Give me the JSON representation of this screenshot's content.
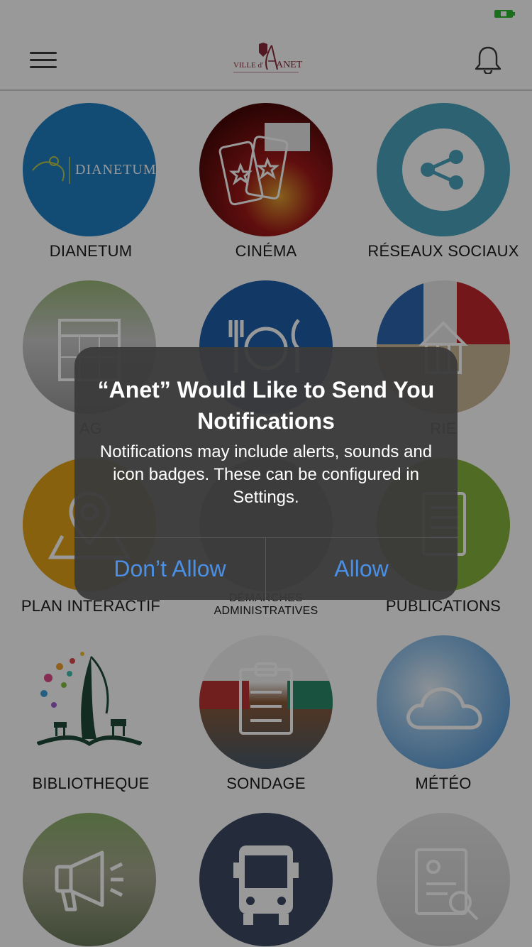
{
  "header": {
    "logo_prefix": "VILLE d'",
    "logo_name": "ANET"
  },
  "tiles": [
    {
      "label": "DIANETUM",
      "logo_text": "DIANETUM",
      "icon": "dianetum-logo",
      "bg": "#1f7fc4"
    },
    {
      "label": "CINÉMA",
      "icon": "cinema-tickets-icon",
      "bg": "#6b1414"
    },
    {
      "label": "RÉSEAUX SOCIAUX",
      "icon": "share-icon",
      "bg": "#4aa3bd"
    },
    {
      "label": "AG",
      "icon": "calendar-icon",
      "bg": "#b0b0b0"
    },
    {
      "label": "",
      "icon": "restaurant-icon",
      "bg": "#1f5fa8"
    },
    {
      "label": "RIE",
      "icon": "town-hall-icon",
      "bg": "#6b86a8"
    },
    {
      "label": "PLAN INTERACTIF",
      "icon": "map-pin-icon",
      "bg": "#e3a21a"
    },
    {
      "label": "DÉMARCHES ADMINISTRATIVES",
      "icon": "admin-icon",
      "bg": "#9a9a9a"
    },
    {
      "label": "PUBLICATIONS",
      "icon": "document-icon",
      "bg": "#86b33b"
    },
    {
      "label": "BIBLIOTHEQUE",
      "icon": "library-logo",
      "bg": "#ffffff"
    },
    {
      "label": "SONDAGE",
      "icon": "survey-icon",
      "bg": "#8a8a8a"
    },
    {
      "label": "MÉTÉO",
      "icon": "cloud-icon",
      "bg": "#4f9bd8"
    },
    {
      "label": "",
      "icon": "megaphone-icon",
      "bg": "#8a9a78"
    },
    {
      "label": "",
      "icon": "bus-icon",
      "bg": "#3c4a64"
    },
    {
      "label": "",
      "icon": "id-search-icon",
      "bg": "#d8d8d8"
    }
  ],
  "alert": {
    "title": "“Anet” Would Like to Send You Notifications",
    "message": "Notifications may include alerts, sounds and icon badges. These can be configured in Settings.",
    "deny_label": "Don’t Allow",
    "allow_label": "Allow"
  },
  "colors": {
    "accent_button": "#4a90e6",
    "battery": "#2eb82e"
  }
}
